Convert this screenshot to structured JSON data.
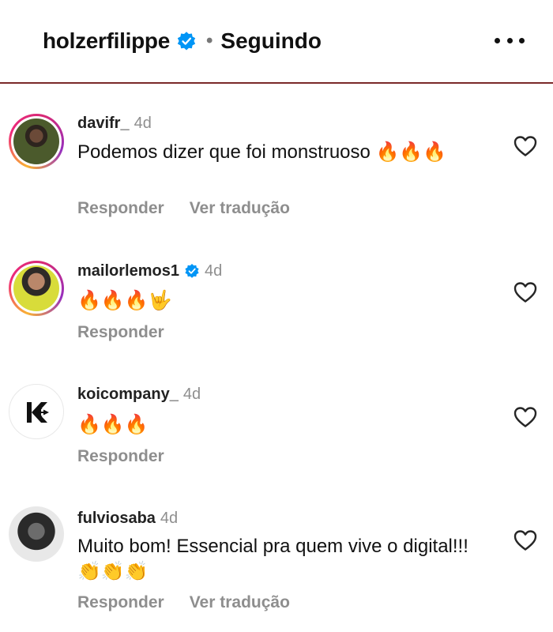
{
  "header": {
    "username": "holzerfilippe",
    "separator": "•",
    "status": "Seguindo"
  },
  "comments": [
    {
      "handle": "davifr_",
      "verified": false,
      "time": "4d",
      "text": "Podemos dizer que foi monstruoso 🔥🔥🔥",
      "actions": [
        "Responder",
        "Ver tradução"
      ]
    },
    {
      "handle": "mailorlemos1",
      "verified": true,
      "time": "4d",
      "text": "🔥🔥🔥🤟",
      "actions": [
        "Responder"
      ]
    },
    {
      "handle": "koicompany_",
      "verified": false,
      "time": "4d",
      "text": "🔥🔥🔥",
      "actions": [
        "Responder"
      ]
    },
    {
      "handle": "fulviosaba",
      "verified": false,
      "time": "4d",
      "text": "Muito bom! Essencial pra quem vive o digital!!!👏👏👏",
      "actions": [
        "Responder",
        "Ver tradução"
      ]
    }
  ],
  "colors": {
    "verified_badge": "#0095f6",
    "muted_text": "#8e8e8e",
    "header_divider": "#7a2a2a"
  },
  "icons": {
    "more": "more-horizontal-icon",
    "like": "heart-outline-icon",
    "verified": "verified-badge-icon"
  }
}
